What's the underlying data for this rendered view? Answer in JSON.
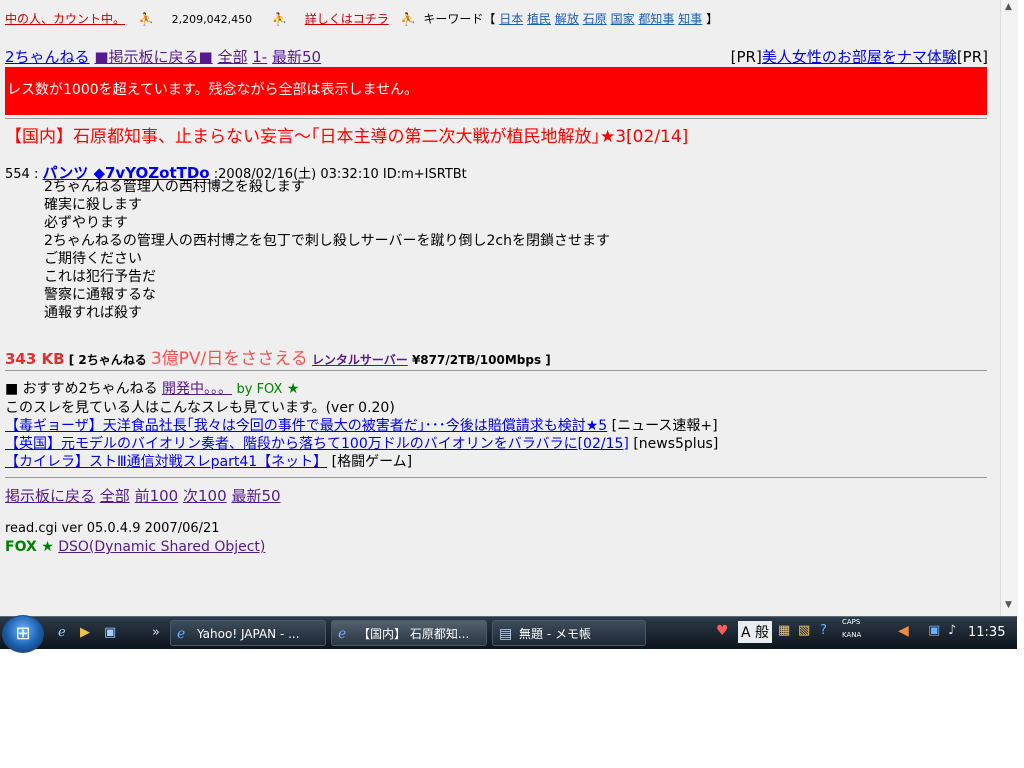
{
  "topbar": {
    "counting_label": "中の人、カウント中。",
    "count_value": "2,209,042,450",
    "details_link": "詳しくはコチラ",
    "keyword_label": "キーワード【",
    "keywords": [
      "日本",
      "植民",
      "解放",
      "石原",
      "国家",
      "都知事",
      "知事"
    ],
    "keyword_close": "】"
  },
  "nav_top": {
    "home": "2ちゃんねる",
    "back": "■掲示板に戻る■",
    "all": "全部",
    "first": "1-",
    "latest": "最新50"
  },
  "pr": {
    "open": "[PR]",
    "link": "美人女性のお部屋をナマ体験",
    "close": "[PR]"
  },
  "alert_text": "レス数が1000を超えています。残念ながら全部は表示しません。",
  "thread_title": "【国内】石原都知事、止まらない妄言〜｢日本主導の第二次大戦が植民地解放｣★3[02/14]",
  "post": {
    "number": "554 :",
    "name": "パンツ ◆7vYOZotTDo",
    "meta": ":2008/02/16(土) 03:32:10 ID:m+ISRTBt",
    "lines": [
      "2ちゃんねる管理人の西村博之を殺します",
      "確実に殺します",
      "必ずやります",
      "2ちゃんねるの管理人の西村博之を包丁で刺し殺しサーバーを蹴り倒し2chを閉鎖させます",
      "ご期待ください",
      "これは犯行予告だ",
      "警察に通報するな",
      "通報すれば殺す"
    ]
  },
  "footer_info": {
    "size": "343 KB",
    "bracket_open": "[",
    "site": "2ちゃんねる",
    "pv": "3億PV/日をささえる",
    "rental": "レンタルサーバー",
    "price": "¥877/2TB/100Mbps",
    "bracket_close": "]"
  },
  "recommend": {
    "label": "■ おすすめ2ちゃんねる",
    "dev_link": "開発中。。。",
    "by": "by FOX",
    "star": "★"
  },
  "see_also": "このスレを見ている人はこんなスレも見ています。(ver 0.20)",
  "related": [
    {
      "title": "【毒ギョーザ】天洋食品社長｢我々は今回の事件で最大の被害者だ｣･･･今後は賠償請求も検討★5",
      "board": "[ニュース速報+]"
    },
    {
      "title": "【英国】元モデルのバイオリン奏者、階段から落ちて100万ドルのバイオリンをバラバラに[02/15]",
      "board": "[news5plus]"
    },
    {
      "title": "【カイレラ】ストⅢ通信対戦スレpart41【ネット】",
      "board": "[格闘ゲーム]"
    }
  ],
  "nav_bottom": {
    "back": "掲示板に戻る",
    "all": "全部",
    "prev": "前100",
    "next": "次100",
    "latest": "最新50"
  },
  "version": "read.cgi ver 05.0.4.9 2007/06/21",
  "fox": {
    "label": "FOX",
    "star": "★",
    "dso_link": "DSO(Dynamic Shared Object)"
  },
  "taskbar": {
    "windows": [
      {
        "label": "Yahoo! JAPAN - ..."
      },
      {
        "label": "【国内】 石原都知..."
      },
      {
        "label": "無題 - メモ帳"
      }
    ],
    "ime": "A 般",
    "caps": "CAPS",
    "kana": "KANA",
    "clock": "11:35"
  }
}
